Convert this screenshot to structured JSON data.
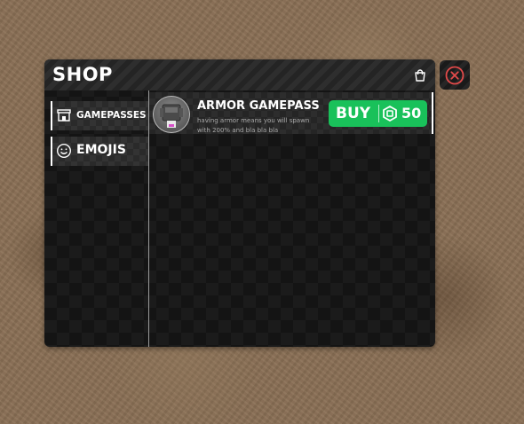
{
  "shop": {
    "title": "SHOP",
    "cart_icon": "shopping-bag-icon",
    "close_icon": "close-x-icon",
    "accent_color": "#19c15a",
    "close_color": "#e24a4a"
  },
  "sidebar": {
    "items": [
      {
        "label": "GAMEPASSES",
        "icon": "storefront-icon"
      },
      {
        "label": "EMOJIS",
        "icon": "smiley-icon"
      }
    ]
  },
  "items": [
    {
      "title": "ARMOR GAMEPASS",
      "description": "having armor means you will spawn with 200% and bla bla bla",
      "avatar_icon": "armor-thumbnail",
      "buy_label": "BUY",
      "currency_icon": "robux-icon",
      "price": "50"
    }
  ]
}
